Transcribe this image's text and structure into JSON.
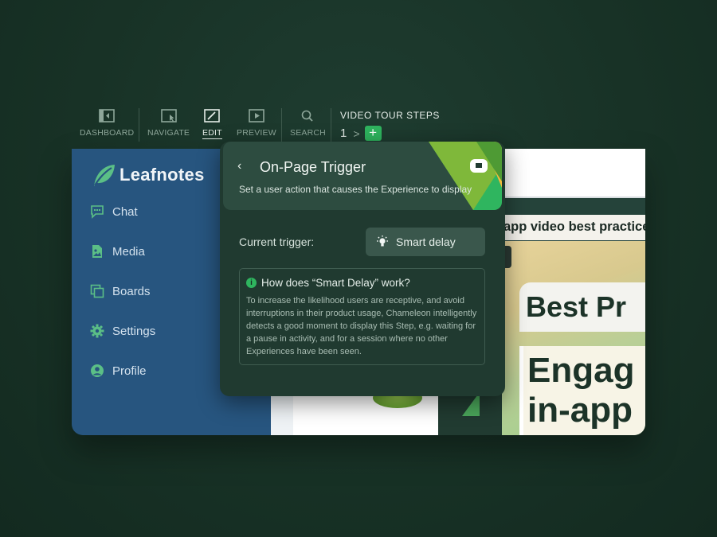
{
  "toolbar": {
    "items": [
      {
        "label": "DASHBOARD",
        "icon": "dashboard-icon"
      },
      {
        "label": "NAVIGATE",
        "icon": "navigate-icon"
      },
      {
        "label": "EDIT",
        "icon": "edit-icon"
      },
      {
        "label": "PREVIEW",
        "icon": "preview-icon"
      },
      {
        "label": "SEARCH",
        "icon": "search-icon"
      }
    ],
    "active": "EDIT",
    "steps_title": "VIDEO TOUR STEPS",
    "current_step": "1",
    "add_label": "+"
  },
  "sidebar": {
    "brand": "Leafnotes",
    "items": [
      {
        "label": "Chat",
        "icon": "chat-icon"
      },
      {
        "label": "Media",
        "icon": "media-icon"
      },
      {
        "label": "Boards",
        "icon": "boards-icon"
      },
      {
        "label": "Settings",
        "icon": "gear-icon"
      },
      {
        "label": "Profile",
        "icon": "profile-icon"
      }
    ]
  },
  "content": {
    "video_title": "app video best practice",
    "hero_line1": "Best Pr",
    "hero_line2": "Engag",
    "hero_line3": "in-app"
  },
  "popover": {
    "back": "‹",
    "title": "On-Page Trigger",
    "subtitle": "Set a user action that causes the Experience to display",
    "trigger_label": "Current trigger:",
    "trigger_value": "Smart delay",
    "info_title": "How does “Smart Delay” work?",
    "info_body": "To increase the likelihood users are receptive, and avoid interruptions in their product usage, Chameleon intelligently detects a good moment to display this Step, e.g. waiting for a pause in activity, and for a session where no other Experiences have been seen."
  },
  "colors": {
    "accent": "#2fb55f",
    "sidebar": "#27557f",
    "background": "#183226"
  }
}
